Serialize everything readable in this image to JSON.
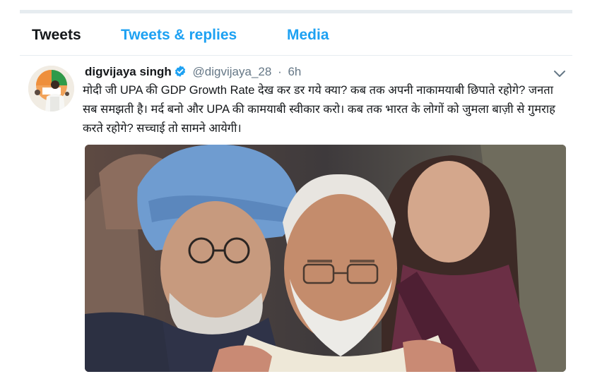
{
  "tabs": [
    {
      "label": "Tweets"
    },
    {
      "label": "Tweets & replies"
    },
    {
      "label": "Media"
    }
  ],
  "tweet": {
    "name": "digvijaya singh",
    "handle": "@digvijaya_28",
    "separator": "·",
    "time": "6h",
    "text": "मोदी जी UPA की GDP Growth Rate देख कर डर गये क्या? कब तक अपनी नाकामयाबी छिपाते रहोगे? जनता सब समझती है। मर्द बनो और UPA की कामयाबी स्वीकार करो। कब तक भारत के लोगों को जुमला बाज़ी से गुमराह करते रहोगे? सच्चाई तो सामने आयेगी।"
  },
  "icons": {
    "verified": "verified-badge-icon",
    "menu": "chevron-down-icon"
  },
  "colors": {
    "accent": "#1da1f2",
    "text": "#14171a",
    "muted": "#657786",
    "divider": "#e6ecf0"
  }
}
